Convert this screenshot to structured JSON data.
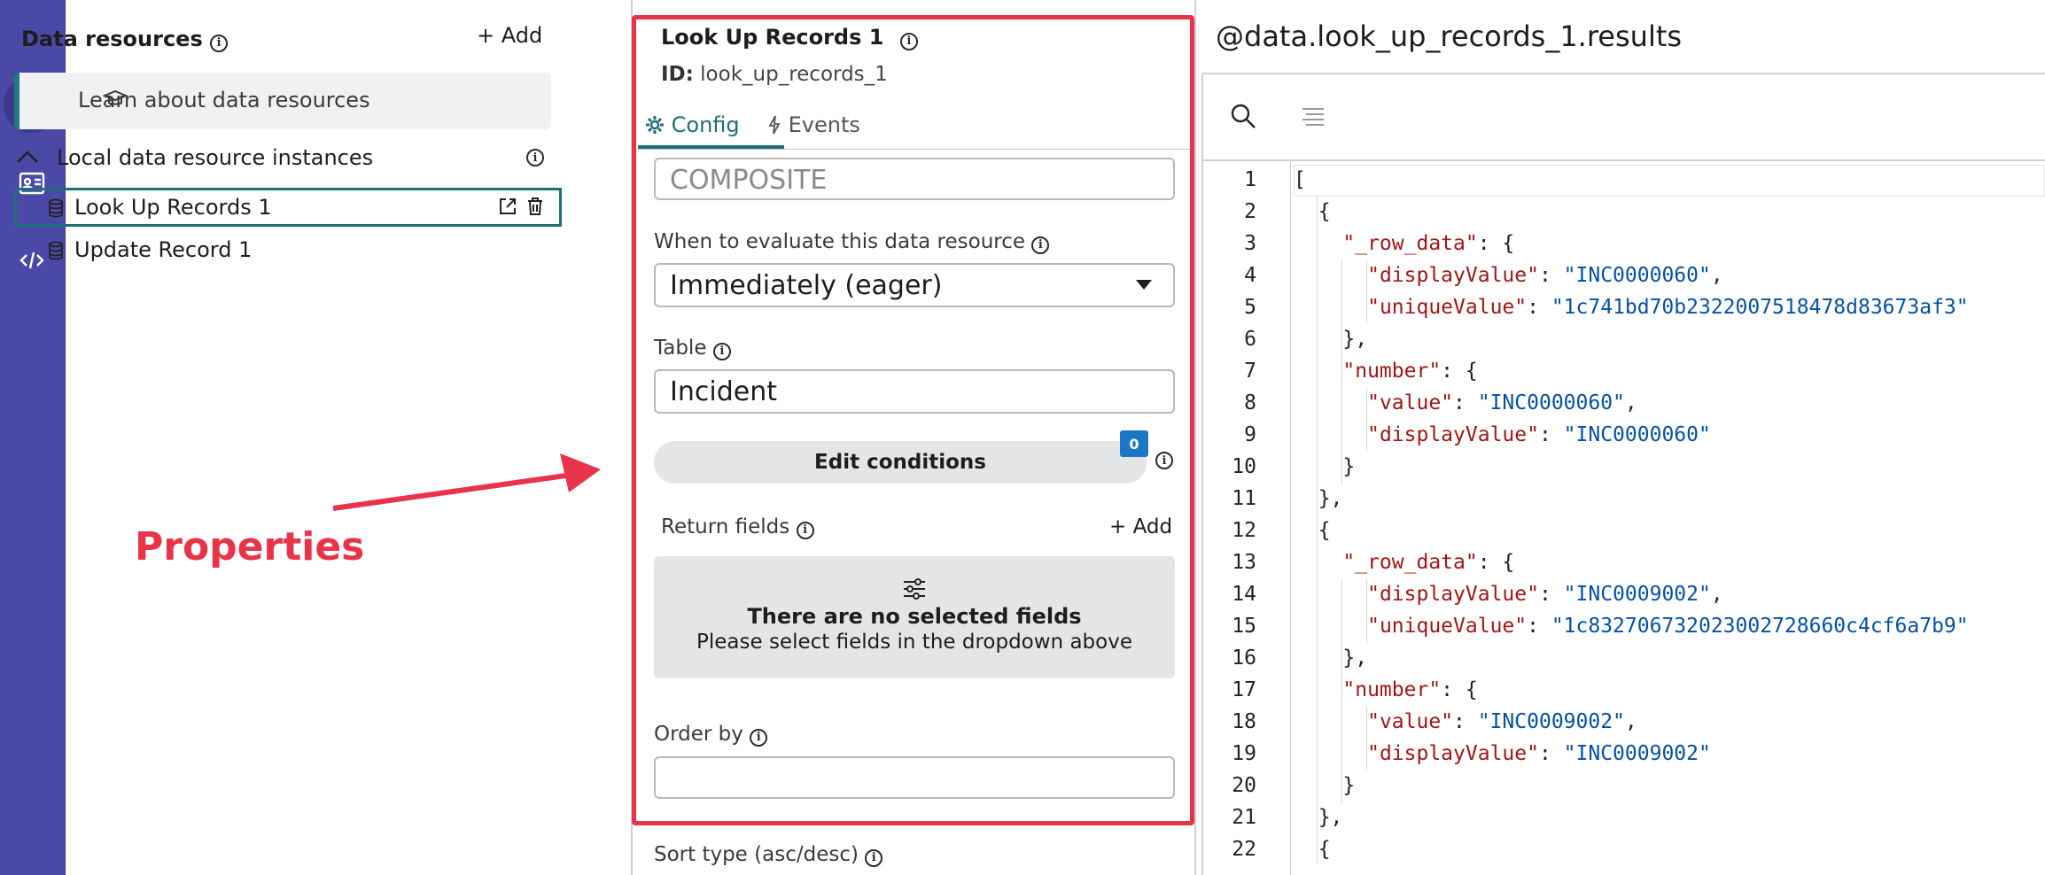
{
  "left_panel": {
    "title": "Data resources",
    "add_label": "+ Add",
    "learn_label": "Learn about data resources",
    "section_label": "Local data resource instances",
    "items": [
      {
        "label": "Look Up Records 1"
      },
      {
        "label": "Update Record 1"
      }
    ]
  },
  "annotation": {
    "label": "Properties",
    "color": "#e9334a"
  },
  "properties": {
    "title": "Look Up Records 1",
    "id_prefix": "ID:",
    "id_value": "look_up_records_1",
    "tabs": [
      {
        "label": "Config",
        "active": true
      },
      {
        "label": "Events",
        "active": false
      }
    ],
    "type_value": "COMPOSITE",
    "eval_label": "When to evaluate this data resource",
    "eval_value": "Immediately (eager)",
    "table_label": "Table",
    "table_value": "Incident",
    "edit_conditions_label": "Edit conditions",
    "conditions_count": "0",
    "return_fields_label": "Return fields",
    "return_add_label": "+ Add",
    "empty_title": "There are no selected fields",
    "empty_subtitle": "Please select fields in the dropdown above",
    "order_by_label": "Order by",
    "order_by_value": "",
    "sort_type_label": "Sort type (asc/desc)"
  },
  "json_panel": {
    "title": "@data.look_up_records_1.results",
    "lines": [
      "1",
      "2",
      "3",
      "4",
      "5",
      "6",
      "7",
      "8",
      "9",
      "10",
      "11",
      "12",
      "13",
      "14",
      "15",
      "16",
      "17",
      "18",
      "19",
      "20",
      "21",
      "22"
    ]
  },
  "colors": {
    "rail": "#4a49a8",
    "accent": "#1f6f76",
    "highlight": "#e9334a",
    "json_key": "#a31515",
    "json_string": "#0451a5"
  }
}
